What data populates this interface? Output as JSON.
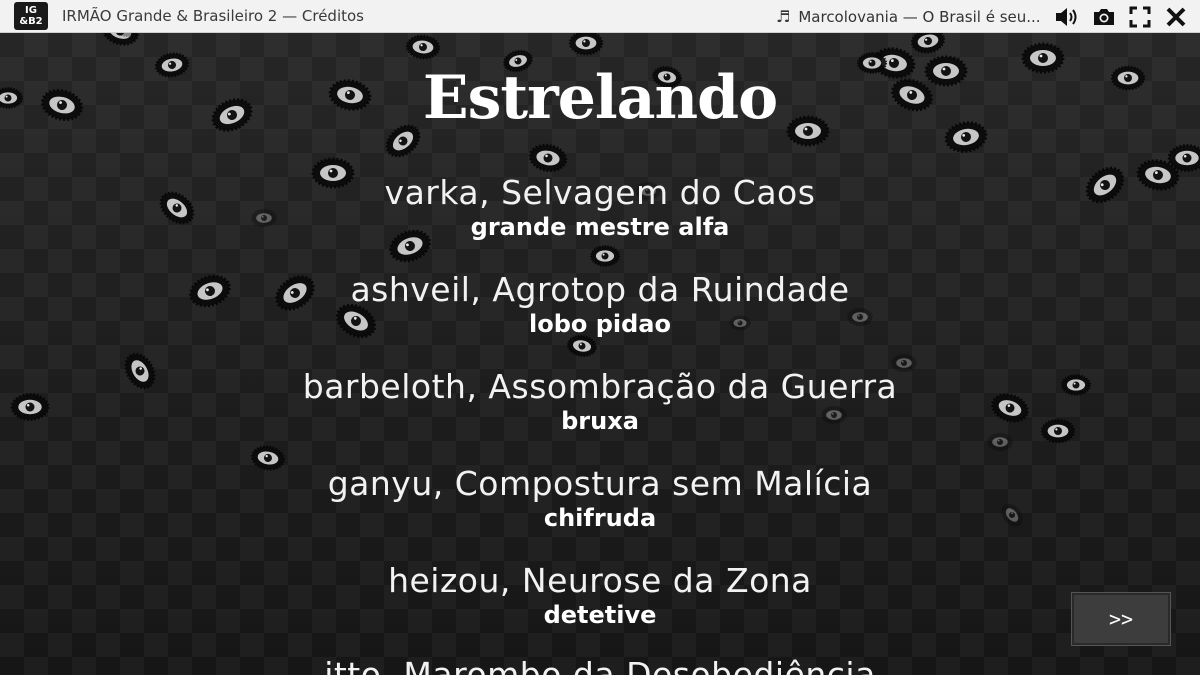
{
  "window": {
    "logo_line1": "IG",
    "logo_line2": "&B2",
    "title": "IRMÃO Grande & Brasileiro 2 — Créditos",
    "music_icon": "music-note-icon",
    "music_text": "Marcolovania — O Brasil é seu...",
    "controls": [
      "volume-icon",
      "camera-icon",
      "fullscreen-icon",
      "close-icon"
    ]
  },
  "credits": {
    "heading": "Estrelando",
    "entries": [
      {
        "name": "varka, Selvagem do Caos",
        "role": "grande mestre alfa"
      },
      {
        "name": "ashveil, Agrotop da Ruindade",
        "role": "lobo pidao"
      },
      {
        "name": "barbeloth, Assombração da Guerra",
        "role": "bruxa"
      },
      {
        "name": "ganyu, Compostura sem Malícia",
        "role": "chifruda"
      },
      {
        "name": "heizou, Neurose da Zona",
        "role": "detetive"
      },
      {
        "name": "itto, Marombo da Desobediência",
        "role": ""
      }
    ]
  },
  "skip_button": {
    "label": ">>"
  },
  "colors": {
    "background": "#1b1b1b",
    "titlebar": "#f2f2f2",
    "text": "#ffffff"
  }
}
